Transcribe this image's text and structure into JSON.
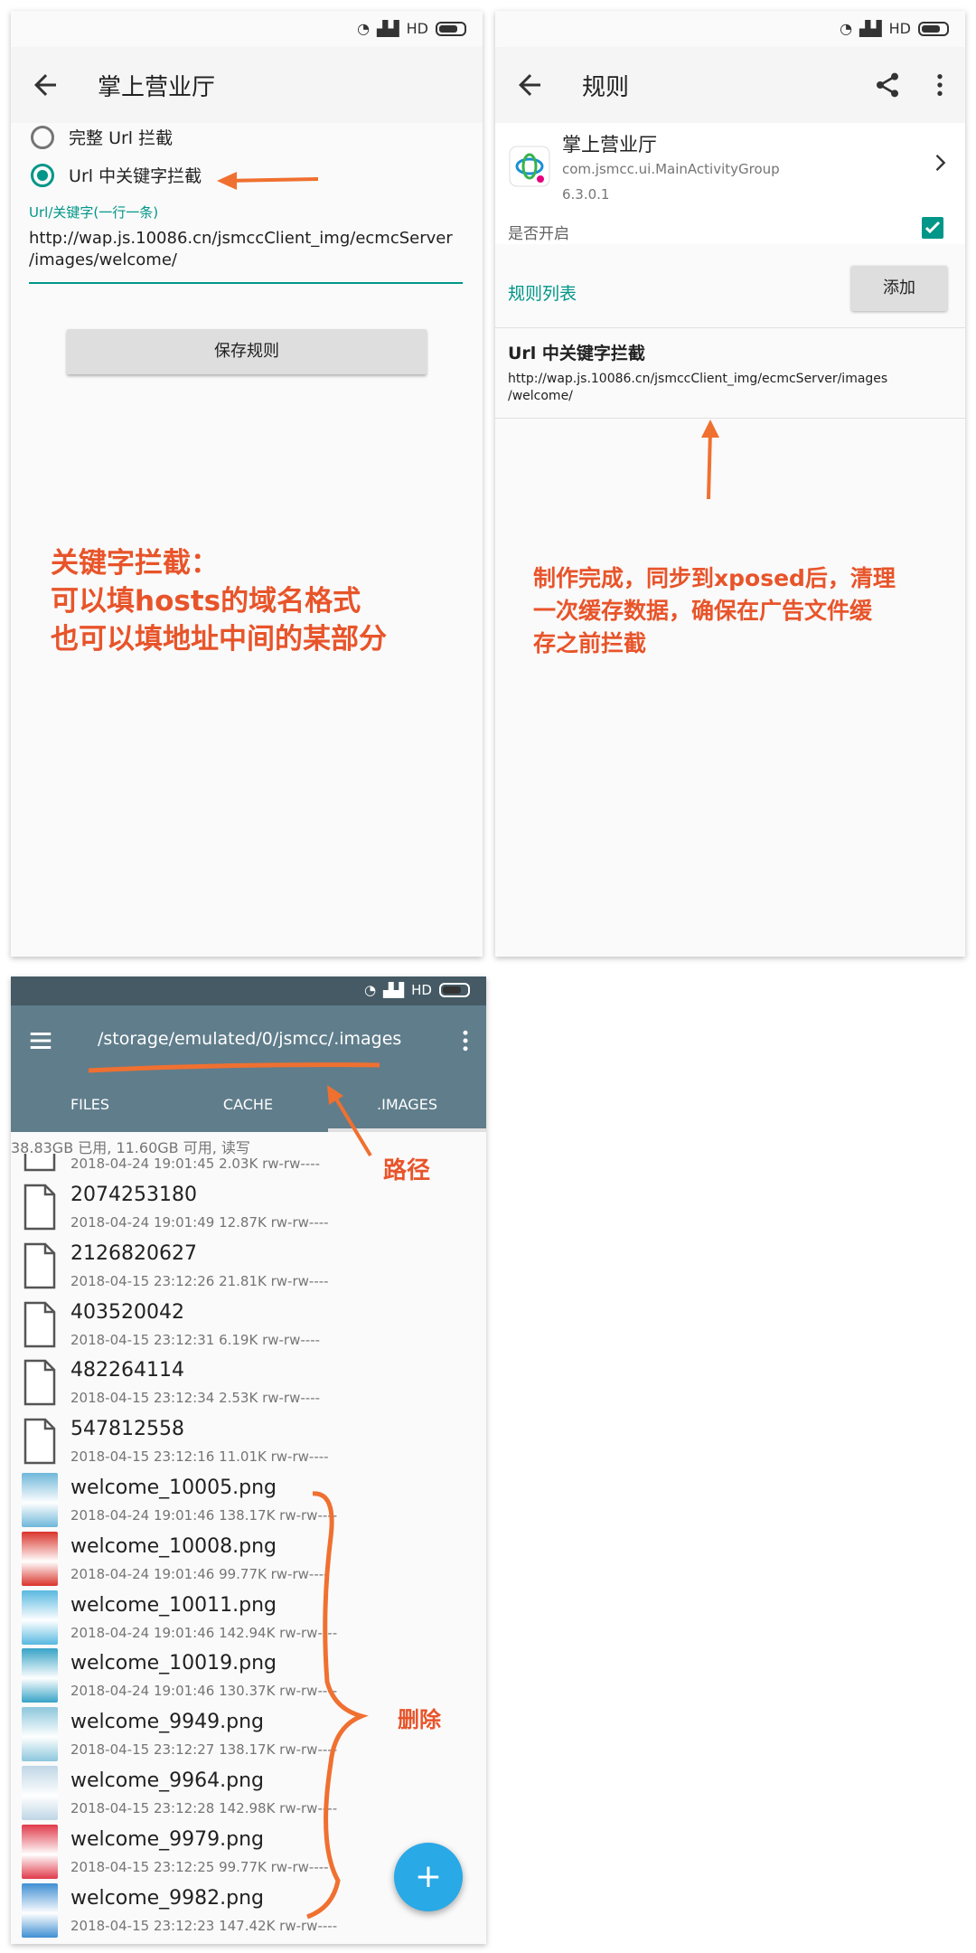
{
  "status": {
    "network": "HD"
  },
  "p1": {
    "title": "掌上营业厅",
    "option_full": "完整 Url 拦截",
    "option_keyword": "Url 中关键字拦截",
    "field_label": "Url/关键字(一行一条)",
    "field_line1": "http://wap.js.10086.cn/jsmccClient_img/ecmcServer",
    "field_line2": "/images/welcome/",
    "save_button": "保存规则",
    "note_line1": "关键字拦截：",
    "note_line2": "可以填hosts的域名格式",
    "note_line3": "也可以填地址中间的某部分"
  },
  "p2": {
    "title": "规则",
    "app_name": "掌上营业厅",
    "package": "com.jsmcc.ui.MainActivityGroup",
    "version": "6.3.0.1",
    "enable_label": "是否开启",
    "enabled": true,
    "rules_header": "规则列表",
    "add_button": "添加",
    "rule_title": "Url 中关键字拦截",
    "rule_line1": "http://wap.js.10086.cn/jsmccClient_img/ecmcServer/images",
    "rule_line2": "/welcome/",
    "note_line1": "制作完成，同步到xposed后，清理",
    "note_line2": "一次缓存数据，确保在广告文件缓",
    "note_line3": "存之前拦截"
  },
  "p3": {
    "path": "/storage/emulated/0/jsmcc/.images",
    "tabs": [
      "FILES",
      "CACHE",
      ".IMAGES"
    ],
    "storage_info": "38.83GB 已用, 11.60GB 可用, 读写",
    "partial_meta": "2018-04-24 19:01:45  2.03K  rw-rw----",
    "files": [
      {
        "name": "2074253180",
        "meta": "2018-04-24 19:01:49  12.87K  rw-rw----",
        "type": "file"
      },
      {
        "name": "2126820627",
        "meta": "2018-04-15 23:12:26  21.81K  rw-rw----",
        "type": "file"
      },
      {
        "name": "403520042",
        "meta": "2018-04-15 23:12:31  6.19K  rw-rw----",
        "type": "file"
      },
      {
        "name": "482264114",
        "meta": "2018-04-15 23:12:34  2.53K  rw-rw----",
        "type": "file"
      },
      {
        "name": "547812558",
        "meta": "2018-04-15 23:12:16  11.01K  rw-rw----",
        "type": "file"
      },
      {
        "name": "welcome_10005.png",
        "meta": "2018-04-24 19:01:46  138.17K  rw-rw----",
        "type": "image",
        "color": "#6fb7d9"
      },
      {
        "name": "welcome_10008.png",
        "meta": "2018-04-24 19:01:46  99.77K  rw-rw----",
        "type": "image",
        "color": "#d9342b"
      },
      {
        "name": "welcome_10011.png",
        "meta": "2018-04-24 19:01:46  142.94K  rw-rw----",
        "type": "image",
        "color": "#58b8e0"
      },
      {
        "name": "welcome_10019.png",
        "meta": "2018-04-24 19:01:46  130.37K  rw-rw----",
        "type": "image",
        "color": "#37a3c6"
      },
      {
        "name": "welcome_9949.png",
        "meta": "2018-04-15 23:12:27  138.17K  rw-rw----",
        "type": "image",
        "color": "#8cc7dc"
      },
      {
        "name": "welcome_9964.png",
        "meta": "2018-04-15 23:12:28  142.98K  rw-rw----",
        "type": "image",
        "color": "#bfd6e6"
      },
      {
        "name": "welcome_9979.png",
        "meta": "2018-04-15 23:12:25  99.77K  rw-rw----",
        "type": "image",
        "color": "#e03a4a"
      },
      {
        "name": "welcome_9982.png",
        "meta": "2018-04-15 23:12:23  147.42K  rw-rw----",
        "type": "image",
        "color": "#3f8fd2"
      }
    ],
    "annot_path": "路径",
    "annot_delete": "删除",
    "fab_label": "+"
  },
  "colors": {
    "accent": "#009688",
    "annotation": "#e8542a",
    "fab": "#29a9e6",
    "appbar": "#607d8b"
  }
}
